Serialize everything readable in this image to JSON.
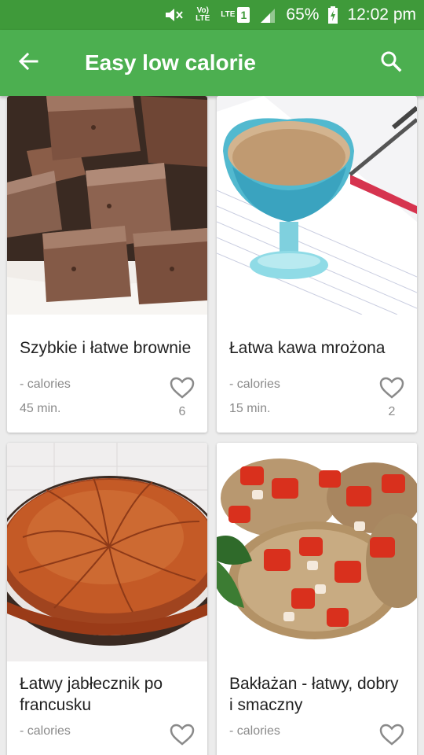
{
  "status_bar": {
    "volte_label": "Vo) LTE",
    "lte_label": "LTE",
    "sim_label": "1",
    "battery": "65%",
    "time": "12:02 pm"
  },
  "app_bar": {
    "title": "Easy low calorie",
    "back_icon": "arrow-back-icon",
    "search_icon": "search-icon"
  },
  "colors": {
    "status_bar": "#3f9a3a",
    "app_bar": "#4caf50",
    "background": "#ececec"
  },
  "recipes": [
    {
      "name": "Szybkie i łatwe brownie",
      "calories": "- calories",
      "time": "45 min.",
      "likes": "6",
      "image": "brownie-photo"
    },
    {
      "name": "Łatwa kawa mrożona",
      "calories": "- calories",
      "time": "15 min.",
      "likes": "2",
      "image": "iced-coffee-photo"
    },
    {
      "name": "Łatwy jabłecznik po francusku",
      "calories": "- calories",
      "time": "",
      "likes": "",
      "image": "apple-pie-photo"
    },
    {
      "name": "Bakłażan - łatwy, dobry i smaczny",
      "calories": "- calories",
      "time": "",
      "likes": "",
      "image": "eggplant-photo"
    }
  ]
}
